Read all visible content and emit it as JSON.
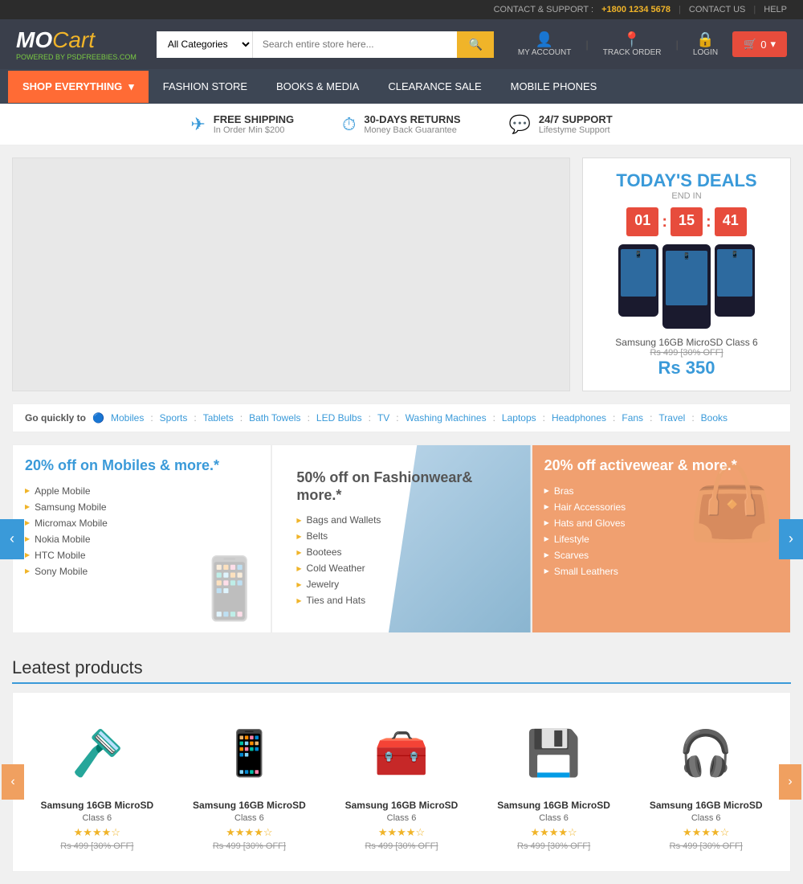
{
  "topbar": {
    "support_label": "CONTACT & SUPPORT :",
    "phone": "+1800 1234 5678",
    "sep1": "|",
    "contact_us": "CONTACT US",
    "sep2": "|",
    "help": "HELP"
  },
  "header": {
    "logo_mo": "MO",
    "logo_cart": "Cart",
    "logo_powered": "POWERED BY PSDFREEBIES.COM",
    "category_default": "All Categories",
    "search_placeholder": "Search entire store here...",
    "my_account": "MY ACCOUNT",
    "track_order": "TRACK ORDER",
    "login": "LOGIN",
    "cart_count": "0"
  },
  "nav": {
    "shop_everything": "SHOP EVERYTHING",
    "items": [
      {
        "label": "FASHION STORE"
      },
      {
        "label": "BOOKS & MEDIA"
      },
      {
        "label": "CLEARANCE SALE"
      },
      {
        "label": "MOBILE PHONES"
      }
    ]
  },
  "infobar": [
    {
      "icon": "✈",
      "title": "FREE SHIPPING",
      "sub": "In Order Min $200"
    },
    {
      "icon": "⏱",
      "title": "30-DAYS RETURNS",
      "sub": "Money Back Guarantee"
    },
    {
      "icon": "💬",
      "title": "24/7 SUPPORT",
      "sub": "Lifestyme Support"
    }
  ],
  "deals": {
    "title": "TODAY'S DEALS",
    "end_in": "END IN",
    "hours": "01",
    "minutes": "15",
    "seconds": "41",
    "product_name": "Samsung 16GB MicroSD Class 6",
    "old_price": "Rs 499 [30% OFF]",
    "new_price": "Rs 350"
  },
  "quicknav": {
    "label": "Go quickly to",
    "items": [
      "Mobiles",
      "Sports",
      "Tablets",
      "Bath Towels",
      "LED Bulbs",
      "TV",
      "Washing Machines",
      "Laptops",
      "Headphones",
      "Fans",
      "Travel",
      "Books"
    ]
  },
  "promos": [
    {
      "title": "20% off on Mobiles & more.*",
      "items": [
        "Apple Mobile",
        "Samsung Mobile",
        "Micromax Mobile",
        "Nokia Mobile",
        "HTC Mobile",
        "Sony Mobile"
      ]
    },
    {
      "title": "50% off on Fashionwear& more.*",
      "items": [
        "Bags and Wallets",
        "Belts",
        "Bootees",
        "Cold Weather",
        "Jewelry",
        "Ties and Hats"
      ]
    },
    {
      "title": "20% off activewear & more.*",
      "items": [
        "Bras",
        "Hair Accessories",
        "Hats and Gloves",
        "Lifestyle",
        "Scarves",
        "Small Leathers"
      ]
    }
  ],
  "products": {
    "title": "Leatest products",
    "items": [
      {
        "name": "Samsung 16GB MicroSD",
        "sub": "Class 6",
        "stars": "★★★★☆",
        "old": "Rs 499 [30% OFF]",
        "emoji": "🪒"
      },
      {
        "name": "Samsung 16GB MicroSD",
        "sub": "Class 6",
        "stars": "★★★★☆",
        "old": "Rs 499 [30% OFF]",
        "emoji": "📱"
      },
      {
        "name": "Samsung 16GB MicroSD",
        "sub": "Class 6",
        "stars": "★★★★☆",
        "old": "Rs 499 [30% OFF]",
        "emoji": "🧰"
      },
      {
        "name": "Samsung 16GB MicroSD",
        "sub": "Class 6",
        "stars": "★★★★☆",
        "old": "Rs 499 [30% OFF]",
        "emoji": "💾"
      },
      {
        "name": "Samsung 16GB MicroSD",
        "sub": "Class 6",
        "stars": "★★★★☆",
        "old": "Rs 499 [30% OFF]",
        "emoji": "🎧"
      }
    ]
  }
}
